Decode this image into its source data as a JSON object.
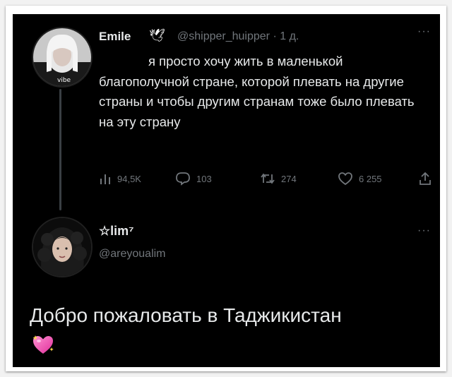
{
  "tweet": {
    "author_name": "Emile",
    "author_handle": "@shipper_huipper",
    "time": "1 д.",
    "separator": "·",
    "text": "я просто хочу жить в маленькой благополучной стране, которой плевать на другие страны и чтобы другим странам тоже было плевать на эту страну",
    "stats": {
      "views": "94,5K",
      "replies": "103",
      "retweets": "274",
      "likes": "6 255"
    },
    "more": "···"
  },
  "reply": {
    "author_name": "☆lim⁷",
    "author_handle": "@areyoualim",
    "text": "Добро пожаловать в Таджикистан",
    "more": "···"
  },
  "colors": {
    "background": "#000000",
    "text": "#e7e9ea",
    "muted": "#71767b",
    "heart_pink": "#f05ab4"
  },
  "icons": [
    "dove-icon",
    "views-icon",
    "reply-icon",
    "retweet-icon",
    "like-icon",
    "share-icon",
    "sparkling-heart-icon",
    "more-icon"
  ]
}
